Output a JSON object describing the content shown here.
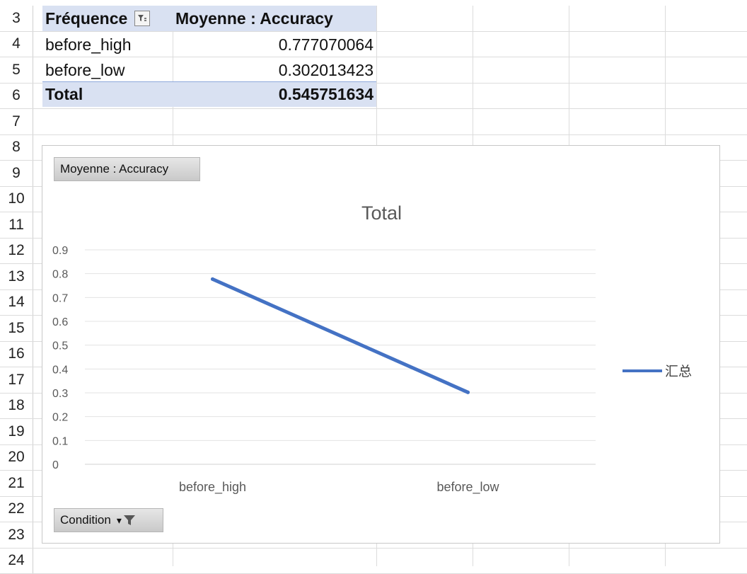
{
  "row_numbers": [
    "3",
    "4",
    "5",
    "6",
    "7",
    "8",
    "9",
    "10",
    "11",
    "12",
    "13",
    "14",
    "15",
    "16",
    "17",
    "18",
    "19",
    "20",
    "21",
    "22",
    "23",
    "24"
  ],
  "pivot": {
    "header_row_label": "Fréquence",
    "header_value_label": "Moyenne : Accuracy",
    "rows": [
      {
        "label": "before_high",
        "value": "0.777070064"
      },
      {
        "label": "before_low",
        "value": "0.302013423"
      }
    ],
    "total_label": "Total",
    "total_value": "0.545751634"
  },
  "chart_data": {
    "type": "line",
    "title": "Total",
    "categories": [
      "before_high",
      "before_low"
    ],
    "series": [
      {
        "name": "汇总",
        "values": [
          0.777070064,
          0.302013423
        ],
        "color": "#4472c4"
      }
    ],
    "ylim": [
      0,
      0.9
    ],
    "yticks": [
      "0",
      "0.1",
      "0.2",
      "0.3",
      "0.4",
      "0.5",
      "0.6",
      "0.7",
      "0.8",
      "0.9"
    ],
    "grid": true,
    "legend_position": "right"
  },
  "chart_buttons": {
    "value_field": "Moyenne : Accuracy",
    "axis_field": "Condition"
  },
  "icons": {
    "pivot_filter": "filter-icon",
    "axis_filter": "filter-dropdown-icon"
  }
}
